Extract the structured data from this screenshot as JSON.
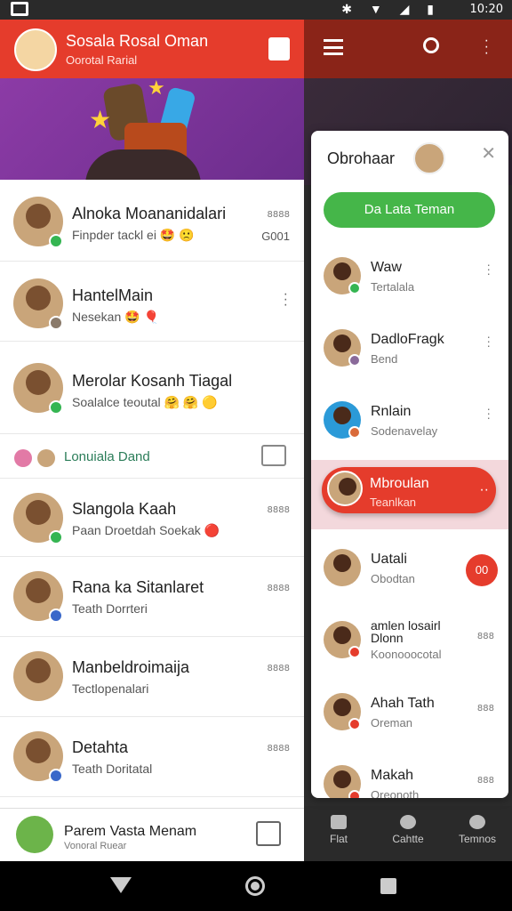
{
  "status_bar": {
    "time": "10:20"
  },
  "left": {
    "header": {
      "title": "Sosala Rosal Oman",
      "subtitle": "Oorotal Rarial"
    },
    "chats": [
      {
        "name": "Alnoka Moananidalari",
        "message": "Finpder tackl ei 🤩 🙁",
        "meta": "8888",
        "meta2": "G001",
        "badge_color": "#35b552"
      },
      {
        "name": "HantelMain",
        "message": "Nesekan 🤩 🎈",
        "meta": "",
        "meta2": "",
        "badge_color": "#8a7a6a"
      },
      {
        "name": "Merolar Kosanh Tiagal",
        "message": "Soalalce teoutal 🤗 🤗 🟡",
        "meta": "",
        "meta2": "",
        "badge_color": "#35b552"
      }
    ],
    "divider": {
      "label": "Lonuiala Dand"
    },
    "chats2": [
      {
        "name": "Slangola Kaah",
        "message": "Paan Droetdah Soekak 🔴",
        "meta": "8888",
        "badge_color": "#35b552"
      },
      {
        "name": "Rana ka Sitanlaret",
        "message": "Teath Dorrteri",
        "meta": "8888",
        "badge_color": "#3a68c9"
      },
      {
        "name": "Manbeldroimaija",
        "message": "Tectlopenalari",
        "meta": "8888",
        "badge_color": ""
      },
      {
        "name": "Detahta",
        "message": "Teath Doritatal",
        "meta": "8888",
        "badge_color": "#3a68c9"
      }
    ],
    "footer": {
      "title": "Parem Vasta Menam",
      "subtitle": "Vonoral Ruear"
    }
  },
  "drawer": {
    "title": "Obrohaar",
    "green_button": "Da Lata Teman",
    "items": [
      {
        "name": "Waw",
        "sub": "Tertalala",
        "trailing": "more"
      },
      {
        "name": "DadloFragk",
        "sub": "Bend",
        "trailing": "more"
      },
      {
        "name": "Rnlain",
        "sub": "Sodenavelay",
        "trailing": "more"
      },
      {
        "name": "Mbroulan",
        "sub": "Teanlkan",
        "trailing": "active"
      },
      {
        "name": "Uatali",
        "sub": "Obodtan",
        "trailing": "pill",
        "pill_text": "00"
      },
      {
        "name": "amlen losairl",
        "name2": "Dlonn",
        "sub": "Koonooocotal",
        "trailing": "meta",
        "meta": "888"
      },
      {
        "name": "Ahah Tath",
        "sub": "Oreman",
        "trailing": "meta",
        "meta": "888"
      },
      {
        "name": "Makah",
        "sub": "Oreonoth",
        "trailing": "meta",
        "meta": "888"
      }
    ]
  },
  "right_tabs": [
    {
      "label": "Flat",
      "icon": "home-icon"
    },
    {
      "label": "Cahtte",
      "icon": "chat-icon"
    },
    {
      "label": "Temnos",
      "icon": "people-icon"
    }
  ],
  "colors": {
    "primary_red": "#e53c2c",
    "green": "#45b649",
    "banner_purple": "#8c3ba6"
  }
}
